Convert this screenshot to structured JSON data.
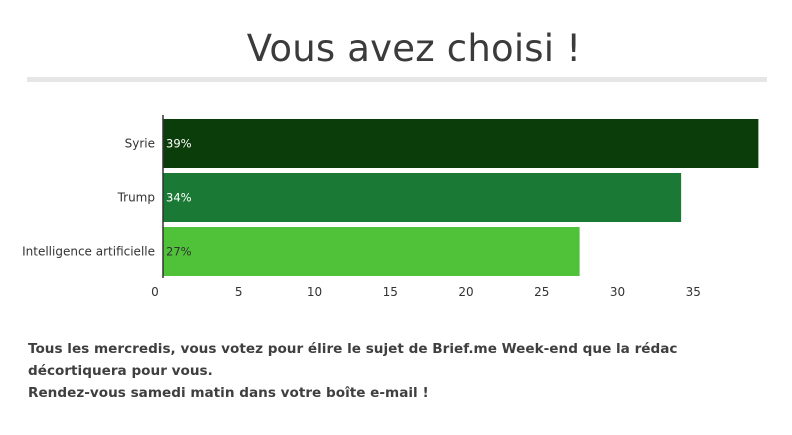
{
  "title": "Vous avez choisi !",
  "chart_data": {
    "type": "bar",
    "orientation": "horizontal",
    "categories": [
      "Syrie",
      "Trump",
      "Intelligence artificielle"
    ],
    "values": [
      39.3,
      34.2,
      27.5
    ],
    "data_labels": [
      "39%",
      "34%",
      "27%"
    ],
    "colors": [
      "#0b3d0b",
      "#1a7a35",
      "#4fc23a"
    ],
    "label_colors": [
      "#ffffff",
      "#ffffff",
      "#333333"
    ],
    "xticks": [
      0,
      5,
      10,
      15,
      20,
      25,
      30,
      35
    ],
    "xlim": [
      0,
      39.5
    ],
    "grid": false,
    "legend": "none"
  },
  "footer": {
    "line1": "Tous les mercredis, vous votez pour élire le sujet de Brief.me Week-end que la rédac décortiquera pour vous.",
    "line2": "Rendez-vous samedi matin dans votre boîte e-mail !"
  }
}
